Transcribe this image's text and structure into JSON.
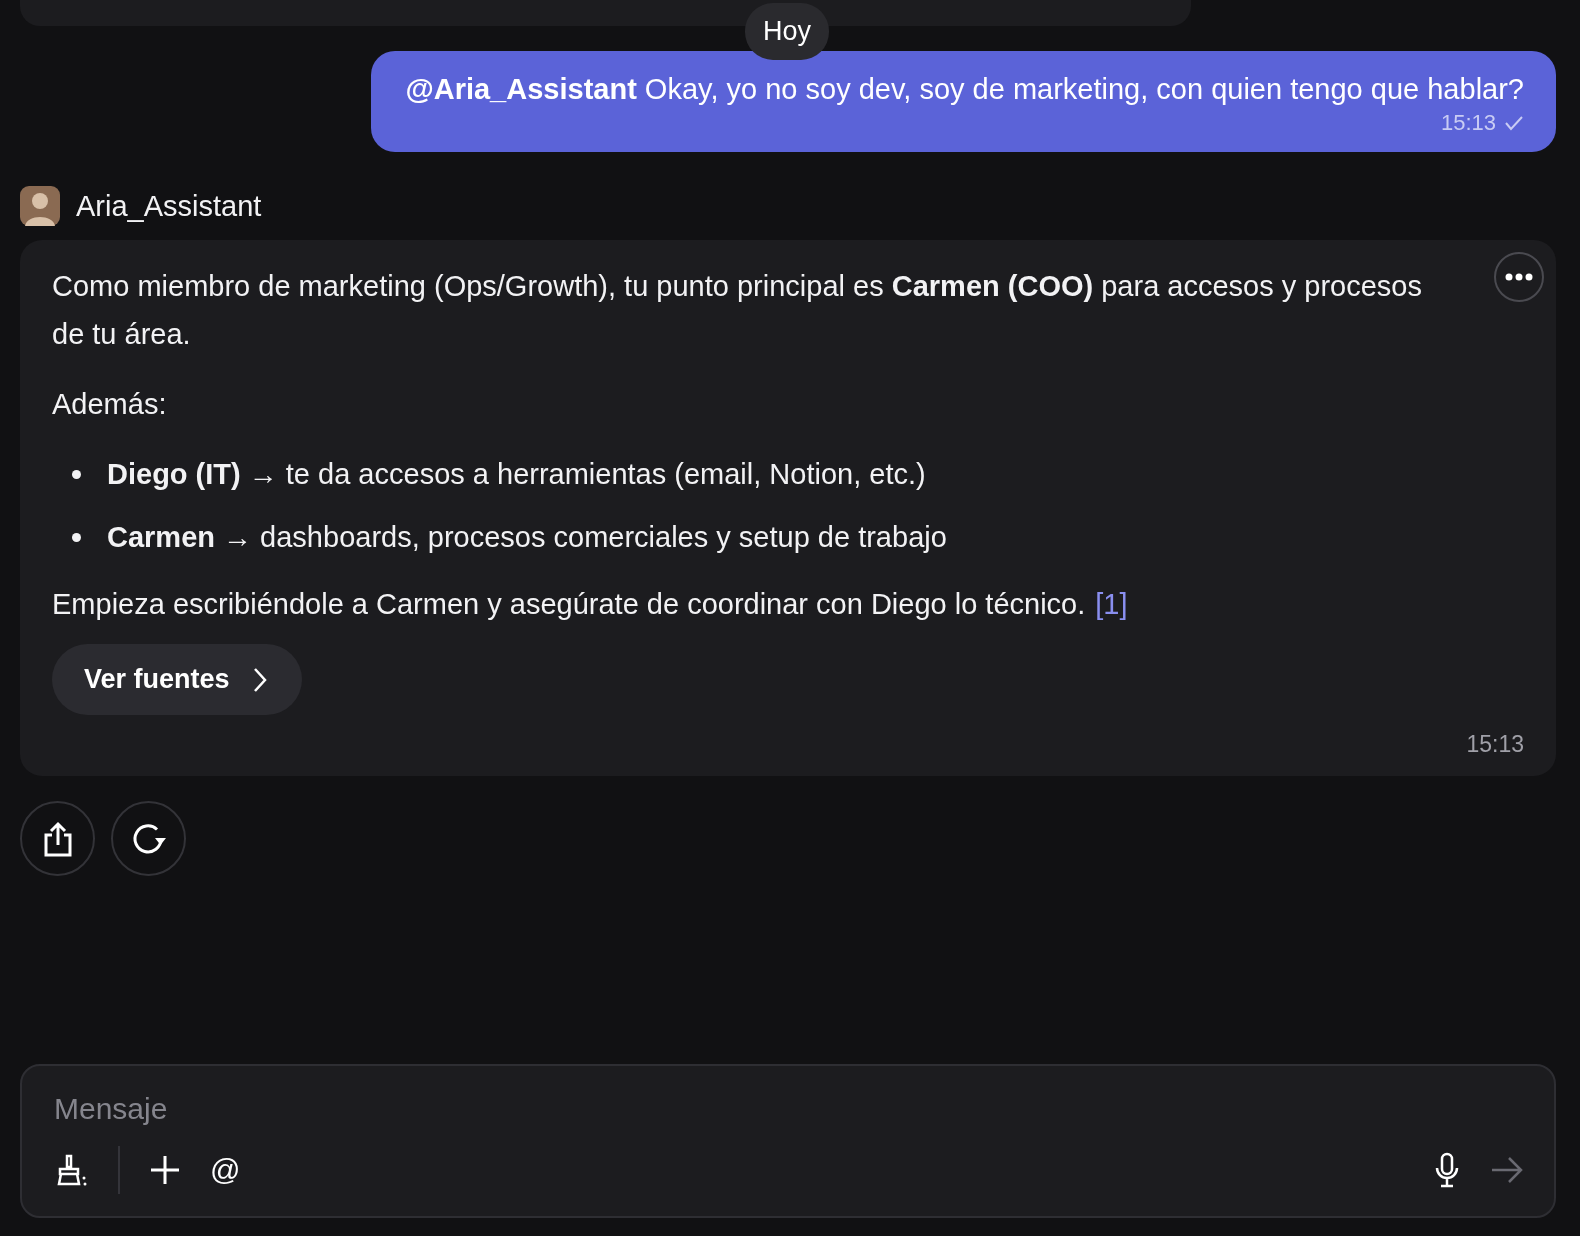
{
  "date_separator": "Hoy",
  "user_message": {
    "text": "**@Aria_Assistant** Okay, yo no soy dev, soy de marketing, con quien tengo que hablar?",
    "time": "15:13",
    "read": true
  },
  "assistant": {
    "name": "Aria_Assistant",
    "paragraphs": [
      "Como miembro de marketing (Ops/Growth), tu punto principal es **Carmen (COO)** para accesos y procesos de tu área.",
      "Además:"
    ],
    "bullets": [
      "**Diego (IT)** → te da accesos a herramientas (email, Notion, etc.)",
      "**Carmen** → dashboards, procesos comerciales y setup de trabajo"
    ],
    "closing": "Empieza escribiéndole a Carmen y asegúrate de coordinar con Diego lo técnico.",
    "citation": "[1]",
    "sources_button": "Ver fuentes",
    "time": "15:13"
  },
  "composer": {
    "placeholder": "Mensaje",
    "mention_button": "@"
  }
}
